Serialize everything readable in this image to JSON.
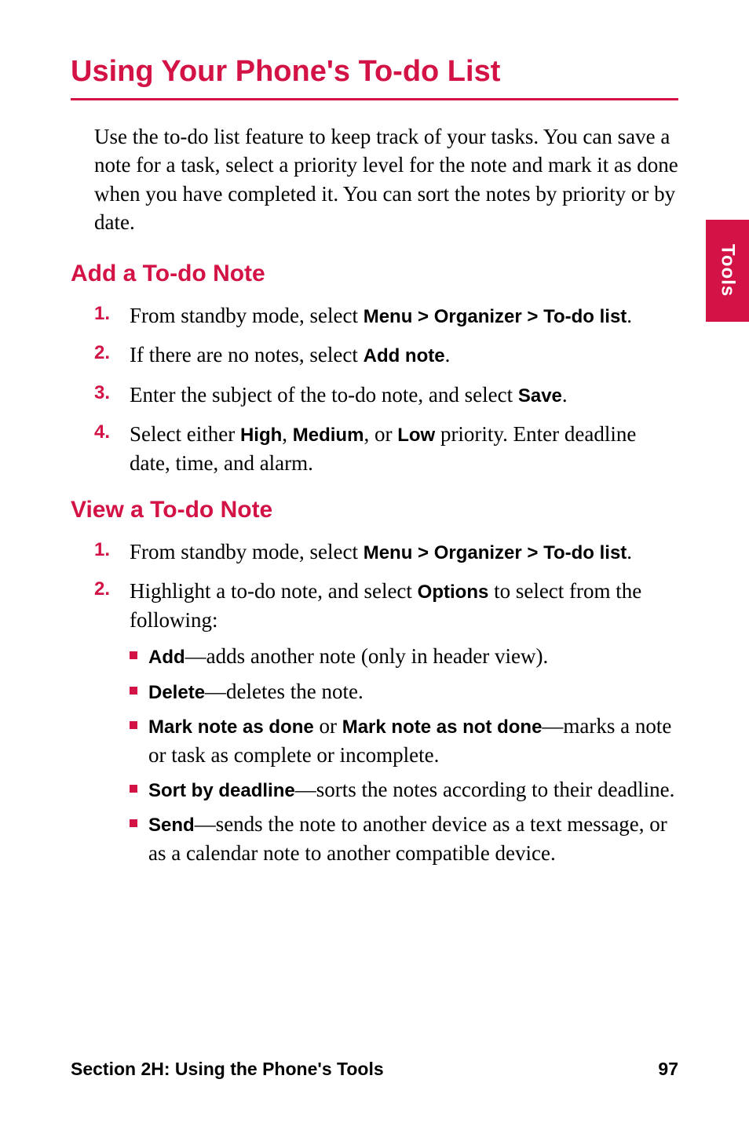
{
  "sideTab": "Tools",
  "title": "Using Your Phone's To-do List",
  "intro": "Use the to-do list feature to keep track of your tasks. You can save a note for a task, select a priority level for the note and mark it as done when you have completed it. You can sort the notes by priority or by date.",
  "section1": {
    "heading": "Add a To-do Note",
    "steps": {
      "s1": {
        "num": "1.",
        "a": "From standby mode, select ",
        "b": "Menu > Organizer > To-do list",
        "c": "."
      },
      "s2": {
        "num": "2.",
        "a": "If there are no notes, select ",
        "b": "Add note",
        "c": "."
      },
      "s3": {
        "num": "3.",
        "a": "Enter the subject of the to-do note, and select ",
        "b": "Save",
        "c": "."
      },
      "s4": {
        "num": "4.",
        "a": "Select either ",
        "b": "High",
        "c": ", ",
        "d": "Medium",
        "e": ", or ",
        "f": "Low",
        "g": " priority. Enter deadline date, time, and alarm."
      }
    }
  },
  "section2": {
    "heading": "View a To-do Note",
    "steps": {
      "s1": {
        "num": "1.",
        "a": "From standby mode, select ",
        "b": "Menu > Organizer > To-do list",
        "c": "."
      },
      "s2": {
        "num": "2.",
        "a": "Highlight a to-do note, and select ",
        "b": "Options",
        "c": " to select from the following:"
      }
    },
    "bullets": {
      "b1": {
        "a": "Add",
        "b": "—adds another note (only in header view)."
      },
      "b2": {
        "a": "Delete",
        "b": "—deletes the note."
      },
      "b3": {
        "a": "Mark note as done",
        "b": " or ",
        "c": "Mark note as not done",
        "d": "—marks a note or task as complete or incomplete."
      },
      "b4": {
        "a": "Sort by deadline",
        "b": "—sorts the notes according to their deadline."
      },
      "b5": {
        "a": "Send",
        "b": "—sends the note to another device as a text message, or as a calendar note to another compatible device."
      }
    }
  },
  "footer": {
    "left": "Section 2H: Using the Phone's Tools",
    "right": "97"
  }
}
